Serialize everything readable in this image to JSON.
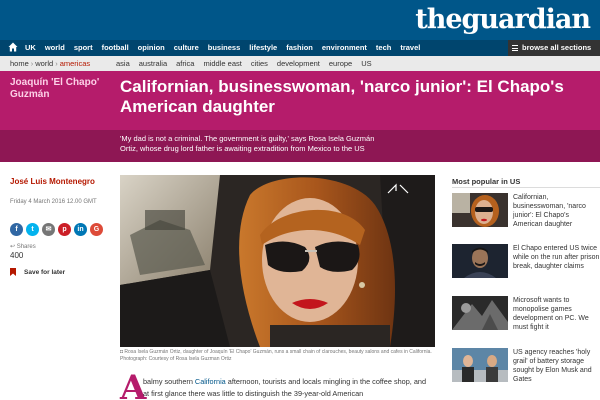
{
  "header": {
    "logo": "theguardian",
    "brand_color": "#005689",
    "nav": [
      "UK",
      "world",
      "sport",
      "football",
      "opinion",
      "culture",
      "business",
      "lifestyle",
      "fashion",
      "environment",
      "tech",
      "travel"
    ],
    "browse_label": "browse all sections"
  },
  "breadcrumb": {
    "items": [
      "home",
      "world",
      "americas"
    ]
  },
  "subnav": [
    "asia",
    "australia",
    "africa",
    "middle east",
    "cities",
    "development",
    "europe",
    "US"
  ],
  "article": {
    "tag": "Joaquín 'El Chapo' Guzmán",
    "headline": "Californian, businesswoman, 'narco junior': El Chapo's American daughter",
    "standfirst": "'My dad is not a criminal. The government is guilty,' says Rosa Isela Guzmán Ortiz, whose drug lord father is awaiting extradition from Mexico to the US",
    "author": "José Luis Montenegro",
    "date": "Friday 4 March 2016 12.00 GMT",
    "shares_label": "Shares",
    "shares_count": "400",
    "save_label": "Save for later",
    "caption": "Rosa Isela Guzmán Ortiz, daughter of Joaquín 'El Chapo' Guzmán, runs a small chain of clarouches, beauty salons and cafes in California. Photograph: Courtesy of Rosa Isela Guzman Ortiz",
    "dropcap": "A",
    "body_pre": "balmy southern ",
    "body_link": "California",
    "body_post": " afternoon, tourists and locals mingling in the coffee shop, and at first glance there was little to distinguish the 39-year-old American",
    "accent_color": "#b51c6b"
  },
  "share_buttons": [
    {
      "icon": "facebook-icon",
      "glyph": "f",
      "color": "#3067a3"
    },
    {
      "icon": "twitter-icon",
      "glyph": "t",
      "color": "#03b3ee"
    },
    {
      "icon": "email-icon",
      "glyph": "✉",
      "color": "#767676"
    },
    {
      "icon": "pinterest-icon",
      "glyph": "p",
      "color": "#cb1f27"
    },
    {
      "icon": "linkedin-icon",
      "glyph": "in",
      "color": "#0077b5"
    },
    {
      "icon": "googleplus-icon",
      "glyph": "G",
      "color": "#dd4b39"
    }
  ],
  "most_popular": {
    "title": "Most popular in US",
    "items": [
      {
        "text": "Californian, businesswoman, 'narco junior': El Chapo's American daughter"
      },
      {
        "text": "El Chapo entered US twice while on the run after prison break, daughter claims"
      },
      {
        "text": "Microsoft wants to monopolise games development on PC. We must fight it"
      },
      {
        "text": "US agency reaches 'holy grail' of battery storage sought by Elon Musk and Gates"
      }
    ]
  }
}
